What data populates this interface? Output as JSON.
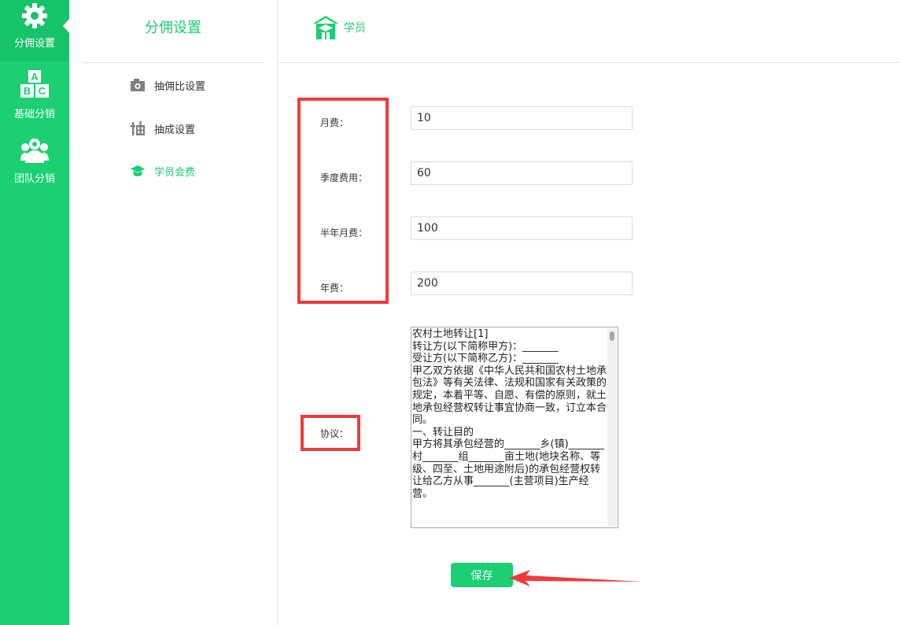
{
  "sidebar": {
    "items": [
      {
        "label": "分佣设置",
        "icon": "gear-icon"
      },
      {
        "label": "基础分销",
        "icon": "abc-blocks-icon"
      },
      {
        "label": "团队分销",
        "icon": "team-icon"
      }
    ]
  },
  "subnav": {
    "title": "分佣设置",
    "items": [
      {
        "label": "抽佣比设置",
        "icon": "camera-icon"
      },
      {
        "label": "抽成设置",
        "icon": "extract-icon"
      },
      {
        "label": "学员会费",
        "icon": "graduation-cap-icon"
      }
    ]
  },
  "header": {
    "breadcrumb": "学员",
    "icon": "school-icon"
  },
  "form": {
    "monthly_label": "月费：",
    "monthly_value": "10",
    "quarterly_label": "季度费用：",
    "quarterly_value": "60",
    "halfyear_label": "半年月费：",
    "halfyear_value": "100",
    "annual_label": "年费：",
    "annual_value": "200",
    "agreement_label": "协议：",
    "agreement_text": "农村土地转让[1]\n转让方(以下简称甲方)：_______\n受让方(以下简称乙方)：_______\n甲乙双方依据《中华人民共和国农村土地承包法》等有关法律、法规和国家有关政策的规定，本着平等、自愿、有偿的原则，就土地承包经营权转让事宜协商一致，订立本合同。\n一、转让目的\n甲方将其承包经营的_______乡(镇)_______村_______组_______亩土地(地块名称、等级、四至、土地用途附后)的承包经营权转让给乙方从事_______(主营项目)生产经营。"
  },
  "save_label": "保存",
  "colors": {
    "brand_green": "#1bcf72",
    "annotation_red": "#f03a3a"
  }
}
